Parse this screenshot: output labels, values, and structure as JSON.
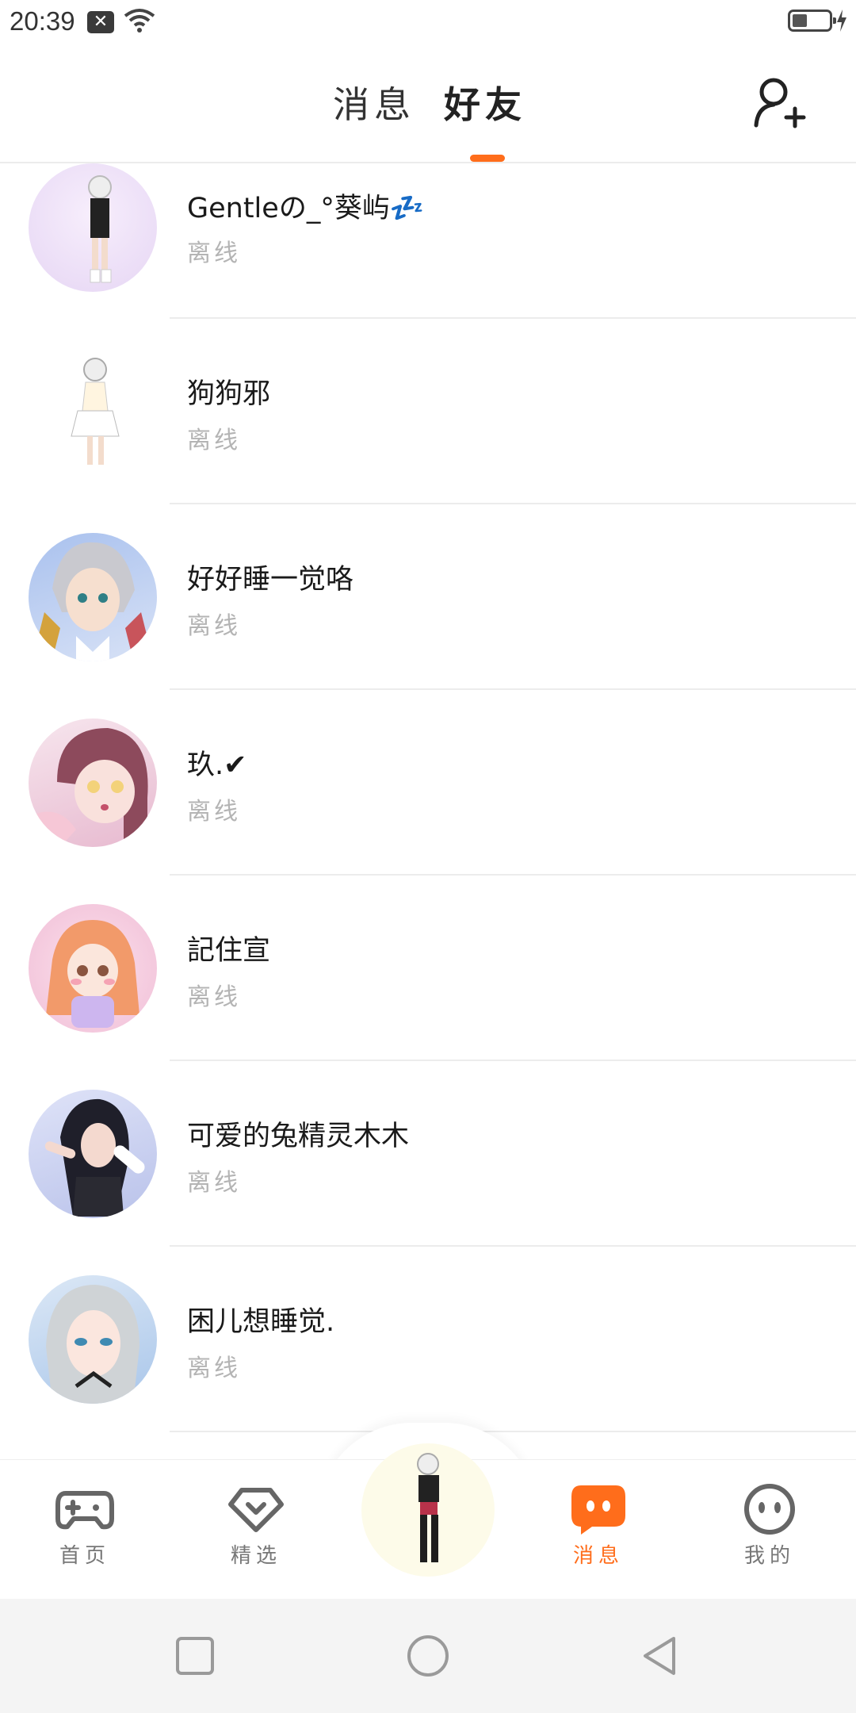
{
  "status_bar": {
    "time": "20:39"
  },
  "header": {
    "tabs": [
      {
        "label": "消息",
        "active": false
      },
      {
        "label": "好友",
        "active": true
      }
    ],
    "accent_color": "#ff6d1b"
  },
  "friends": [
    {
      "name": "Gentleの_°葵屿💤",
      "status": "离线",
      "avatar_bg": "#e9dcf6"
    },
    {
      "name": "狗狗邪",
      "status": "离线",
      "avatar_bg": "#ffffff"
    },
    {
      "name": "好好睡一觉咯",
      "status": "离线",
      "avatar_bg": "#b4c8ec"
    },
    {
      "name": "玖.✔",
      "status": "离线",
      "avatar_bg": "#e9c6d8"
    },
    {
      "name": "記住宣",
      "status": "离线",
      "avatar_bg": "#f6cbe0"
    },
    {
      "name": "可爱的兔精灵木木",
      "status": "离线",
      "avatar_bg": "#c9cff0"
    },
    {
      "name": "困儿想睡觉.",
      "status": "离线",
      "avatar_bg": "#cfe0f4"
    }
  ],
  "bottom_nav": {
    "items": [
      {
        "label": "首页",
        "icon": "gamepad-icon",
        "active": false
      },
      {
        "label": "精选",
        "icon": "heart-gem-icon",
        "active": false
      },
      {
        "label": "消息",
        "icon": "chat-bubble-icon",
        "active": true
      },
      {
        "label": "我的",
        "icon": "face-icon",
        "active": false
      }
    ]
  }
}
